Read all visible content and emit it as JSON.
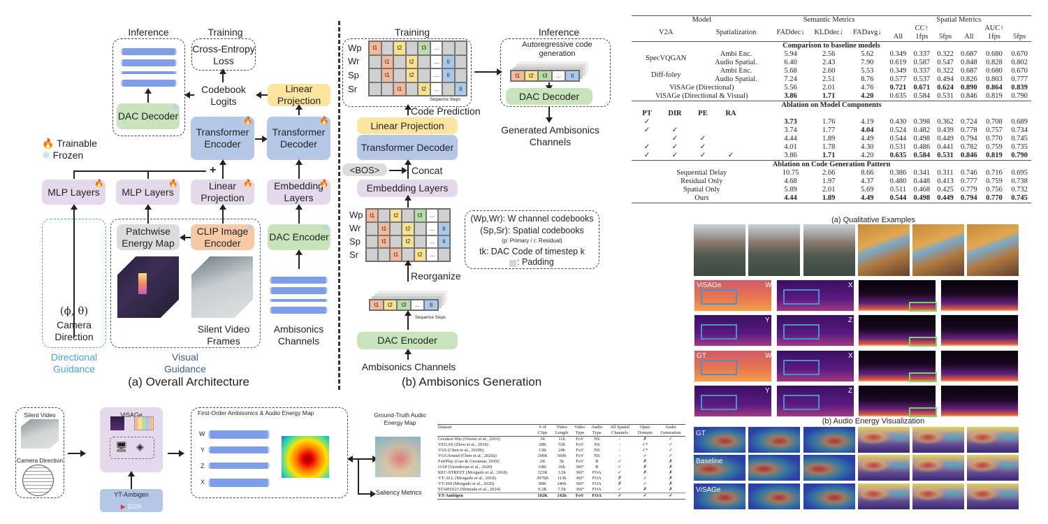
{
  "figure_a": {
    "caption": "(a) Overall Architecture",
    "inference_label": "Inference",
    "training_label": "Training",
    "cross_entropy": "Cross-Entropy Loss",
    "dac_decoder": "DAC Decoder",
    "codebook_logits": "Codebook Logits",
    "linear_projection_top": "Linear Projection",
    "transformer_encoder": "Transformer Encoder",
    "transformer_decoder": "Transformer Decoder",
    "legend_trainable": "Trainable",
    "legend_frozen": "Frozen",
    "plus": "+",
    "mlp_layers_1": "MLP Layers",
    "mlp_layers_2": "MLP Layers",
    "linear_projection_bottom": "Linear Projection",
    "embedding_layers": "Embedding Layers",
    "patchwise_energy_map": "Patchwise Energy Map",
    "clip_image_encoder": "CLIP Image Encoder",
    "dac_encoder": "DAC Encoder",
    "camera_symbol": "(ϕ, θ)",
    "camera_direction": "Camera Direction",
    "silent_video_frames": "Silent Video Frames",
    "ambisonics_channels": "Ambisonics Channels",
    "directional_guidance": "Directional Guidance",
    "visual_guidance": "Visual Guidance"
  },
  "figure_b": {
    "caption": "(b) Ambisonics Generation",
    "training_label": "Training",
    "inference_label": "Inference",
    "row_labels": [
      "Wp",
      "Wr",
      "Sp",
      "Sr"
    ],
    "sequence_steps": "Sequence Steps",
    "autoregressive": "Autoregressive code generation",
    "dac_decoder": "DAC Decoder",
    "generated": "Generated Ambisonics Channels",
    "code_prediction": "Code Prediction",
    "linear_projection": "Linear Projection",
    "transformer_decoder": "Transformer Decoder",
    "bos": "<BOS>",
    "concat": "Concat",
    "embedding_layers": "Embedding Layers",
    "reorganize": "Reorganize",
    "dac_encoder": "DAC Encoder",
    "ambisonics_channels": "Ambisonics Channels",
    "legend": {
      "line1": "(Wp,Wr): W channel codebooks",
      "line2": "(Sp,Sr): Spatial codebooks",
      "line3": "(p: Primary / r: Residual)",
      "line4": "tk: DAC Code of timestep k",
      "line5": ": Padding"
    },
    "tokens": [
      "t1",
      "t2",
      "t3",
      "...",
      "ti"
    ]
  },
  "pipeline": {
    "silent_video": "Silent Video",
    "camera_direction": "Camera Direction",
    "visage": "ViSAGe",
    "yt_ambigen": "YT-Ambigen",
    "yt_count": "102K",
    "foa_title": "First-Order Ambisonics  &  Audio Energy Map",
    "channels": [
      "W",
      "Y",
      "Z",
      "X"
    ],
    "ground_truth": "Ground-Truth Audio Energy Map",
    "saliency": "Saliency Metrics"
  },
  "results_table": {
    "group_headers": {
      "model": "Model",
      "semantic": "Semantic Metrics",
      "spatial": "Spatial Metrics"
    },
    "sub_headers": {
      "v2a": "V2A",
      "spatialization": "Spatialization",
      "fad_dec": "FADdec↓",
      "kld_dec": "KLDdec↓",
      "fad_avg": "FADavg↓",
      "cc": "CC↑",
      "auc": "AUC↑",
      "all": "All",
      "fps1": "1fps",
      "fps5": "5fps"
    },
    "section1": "Comparison to baseline models",
    "baseline_rows": [
      {
        "v2a": "SpecVQGAN",
        "sp": "Ambi Enc.",
        "vals": [
          "5.94",
          "2.56",
          "5.62",
          "0.349",
          "0.337",
          "0.322",
          "0.687",
          "0.680",
          "0.670"
        ]
      },
      {
        "v2a": "",
        "sp": "Audio Spatial.",
        "vals": [
          "6.40",
          "2.43",
          "7.90",
          "0.619",
          "0.587",
          "0.547",
          "0.848",
          "0.828",
          "0.802"
        ]
      },
      {
        "v2a": "Diff-foley",
        "sp": "Ambi Enc.",
        "vals": [
          "5.68",
          "2.60",
          "5.53",
          "0.349",
          "0.337",
          "0.322",
          "0.687",
          "0.680",
          "0.670"
        ]
      },
      {
        "v2a": "",
        "sp": "Audio Spatial.",
        "vals": [
          "7.24",
          "2.51",
          "8.76",
          "0.577",
          "0.537",
          "0.494",
          "0.826",
          "0.803",
          "0.777"
        ]
      },
      {
        "model": "ViSAGe (Directional)",
        "vals": [
          "5.56",
          "2.01",
          "4.76",
          "0.721",
          "0.671",
          "0.624",
          "0.890",
          "0.864",
          "0.839"
        ]
      },
      {
        "model": "ViSAGe (Directional & Visual)",
        "vals": [
          "3.86",
          "1.71",
          "4.20",
          "0.635",
          "0.584",
          "0.531",
          "0.846",
          "0.819",
          "0.790"
        ]
      }
    ],
    "section2": "Ablation on Model Components",
    "ablation_headers": [
      "PT",
      "DIR",
      "PE",
      "RA"
    ],
    "ablation_rows": [
      {
        "checks": [
          "✓",
          "",
          "",
          ""
        ],
        "vals": [
          "3.73",
          "1.76",
          "4.19",
          "0.430",
          "0.398",
          "0.362",
          "0.724",
          "0.708",
          "0.689"
        ]
      },
      {
        "checks": [
          "✓",
          "✓",
          "",
          ""
        ],
        "vals": [
          "3.74",
          "1.77",
          "4.04",
          "0.524",
          "0.482",
          "0.439",
          "0.778",
          "0.757",
          "0.734"
        ]
      },
      {
        "checks": [
          "",
          "✓",
          "✓",
          ""
        ],
        "vals": [
          "4.44",
          "1.89",
          "4.49",
          "0.544",
          "0.498",
          "0.449",
          "0.794",
          "0.770",
          "0.745"
        ]
      },
      {
        "checks": [
          "✓",
          "✓",
          "✓",
          ""
        ],
        "vals": [
          "4.01",
          "1.78",
          "4.30",
          "0.531",
          "0.486",
          "0.441",
          "0.782",
          "0.759",
          "0.735"
        ]
      },
      {
        "checks": [
          "✓",
          "✓",
          "✓",
          "✓"
        ],
        "vals": [
          "3.86",
          "1.71",
          "4.20",
          "0.635",
          "0.584",
          "0.531",
          "0.846",
          "0.819",
          "0.790"
        ]
      }
    ],
    "section3": "Ablation on Code Generation Pattern",
    "pattern_rows": [
      {
        "name": "Sequential Delay",
        "vals": [
          "10.75",
          "2.66",
          "8.66",
          "0.386",
          "0.341",
          "0.311",
          "0.746",
          "0.716",
          "0.695"
        ]
      },
      {
        "name": "Residual Only",
        "vals": [
          "4.68",
          "1.97",
          "4.37",
          "0.480",
          "0.448",
          "0.413",
          "0.777",
          "0.759",
          "0.738"
        ]
      },
      {
        "name": "Spatial Only",
        "vals": [
          "5.89",
          "2.01",
          "5.69",
          "0.511",
          "0.468",
          "0.425",
          "0.779",
          "0.756",
          "0.732"
        ]
      },
      {
        "name": "Ours",
        "vals": [
          "4.44",
          "1.89",
          "4.49",
          "0.544",
          "0.498",
          "0.449",
          "0.794",
          "0.770",
          "0.745"
        ]
      }
    ]
  },
  "dataset_table": {
    "headers": [
      "Dataset",
      "# of Clips",
      "Video Length",
      "Video Type",
      "Audio Type",
      "All Spatial Channels",
      "Open Domain",
      "Audio Generation"
    ],
    "rows": [
      [
        "Greatest Hits (Owens et al., 2016)",
        "1K",
        "11h",
        "FoV",
        "NS",
        "-",
        "✗",
        "✓"
      ],
      [
        "VEGAS (Zhou et al., 2018)",
        "28K",
        "55h",
        "FoV",
        "NS",
        "-",
        "✓*",
        "✓"
      ],
      [
        "VAS (Chen et al., 2020b)",
        "13K",
        "24h",
        "FoV",
        "NS",
        "-",
        "✓*",
        "✓"
      ],
      [
        "VGGSound (Chen et al., 2020a)",
        "200K",
        "560h",
        "FoV",
        "NS",
        "-",
        "✓",
        "✓"
      ],
      [
        "FairPlay (Gao & Grauman, 2019)",
        "2K",
        "5h",
        "FoV",
        "B",
        "✓",
        "✗",
        "✗"
      ],
      [
        "OAP (Vasudevan et al., 2020)",
        "64K",
        "26h",
        "360°",
        "B",
        "✓",
        "✗",
        "✗"
      ],
      [
        "REC-STREET (Morgado et al., 2018)",
        "123K",
        "3.5h",
        "360°",
        "FOA",
        "✓",
        "✗",
        "✗"
      ],
      [
        "YT-ALL (Morgado et al., 2018)",
        "3976K",
        "113h",
        "360°",
        "FOA",
        "✗",
        "✓",
        "✗"
      ],
      [
        "YT-360 (Morgado et al., 2020)",
        "89K",
        "246h",
        "360°",
        "FOA",
        "✗",
        "✓",
        "✗"
      ],
      [
        "STARSS23 (Shimada et al., 2024)",
        "0.2K",
        "7.5h",
        "360°",
        "FOA",
        "✓",
        "✗",
        "✗"
      ],
      [
        "YT-Ambigen",
        "102K",
        "142h",
        "FoV",
        "FOA",
        "✓",
        "✓",
        "✓"
      ]
    ]
  },
  "qualitative": {
    "caption_a": "(a) Qualitative Examples",
    "caption_b": "(b) Audio Energy Visualization",
    "spec_labels": {
      "visage": "ViSAGe",
      "gt": "GT",
      "w": "W",
      "x": "X",
      "y": "Y",
      "z": "Z"
    },
    "energy_row_labels": [
      "GT",
      "Baseline",
      "ViSAGe"
    ]
  },
  "icons": {
    "trainable": "fire-icon",
    "frozen": "snowflake-icon"
  },
  "colors": {
    "purple": "#e4d9ea",
    "blue": "#b4c7e7",
    "yellow": "#fde5a0",
    "green": "#c9e3bd",
    "orange": "#f8c9a7",
    "accent_blue": "#4a90d9",
    "accent_green": "#7dd36a"
  }
}
